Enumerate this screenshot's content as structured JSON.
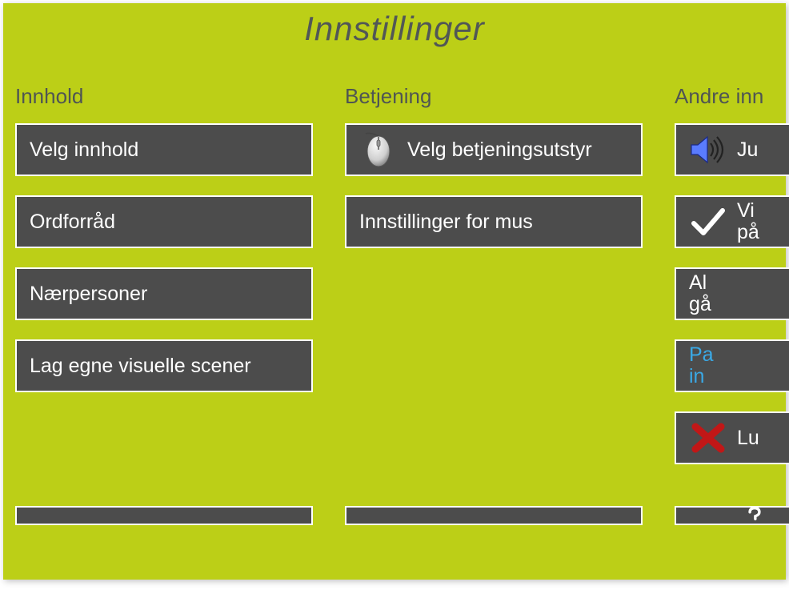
{
  "title": "Innstillinger",
  "columns": {
    "content": {
      "header": "Innhold",
      "items": {
        "select_content": "Velg innhold",
        "vocabulary": "Ordforråd",
        "close_persons": "Nærpersoner",
        "create_scenes": "Lag egne visuelle scener"
      }
    },
    "operation": {
      "header": "Betjening",
      "items": {
        "select_equipment": "Velg betjeningsutstyr",
        "mouse_settings": "Innstillinger for mus"
      }
    },
    "other": {
      "header": "Andre inn",
      "items": {
        "sound": "Ju",
        "check_line1": "Vi",
        "check_line2": "på",
        "row3_line1": "Al",
        "row3_line2": "gå",
        "row4_line1": "Pa",
        "row4_line2": "in",
        "close": "Lu"
      }
    }
  }
}
